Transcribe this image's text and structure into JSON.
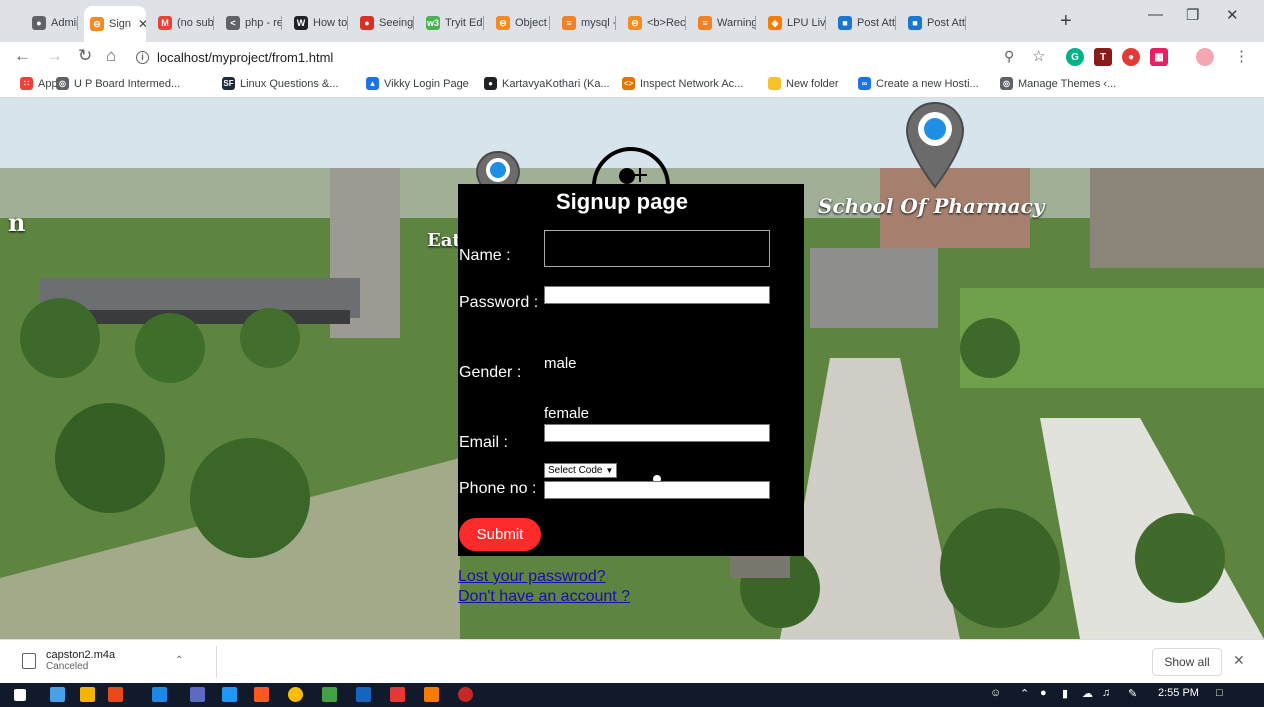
{
  "browser": {
    "tabs": [
      {
        "label": "Admin",
        "icon": "chrome-icon",
        "color": "#5f6368"
      },
      {
        "label": "Sign",
        "icon": "xampp-icon",
        "color": "#f28b22",
        "active": true
      },
      {
        "label": "(no sub",
        "icon": "gmail-icon",
        "color": "#ea4335"
      },
      {
        "label": "php - re",
        "icon": "code-icon",
        "color": "#5f6368"
      },
      {
        "label": "How to",
        "icon": "wiki-icon",
        "color": "#202124"
      },
      {
        "label": "Seeing",
        "icon": "red-circle-icon",
        "color": "#d93025"
      },
      {
        "label": "Tryit Ed",
        "icon": "w3-icon",
        "color": "#4caf50"
      },
      {
        "label": "Object",
        "icon": "xampp-icon",
        "color": "#f28b22"
      },
      {
        "label": "mysql -",
        "icon": "stack-icon",
        "color": "#f48024"
      },
      {
        "label": "<b>Rec",
        "icon": "xampp-icon",
        "color": "#f28b22"
      },
      {
        "label": "Warning",
        "icon": "stack-icon",
        "color": "#f48024"
      },
      {
        "label": "LPU Liv",
        "icon": "lpu-icon",
        "color": "#f57c00"
      },
      {
        "label": "Post Att",
        "icon": "blue-square-icon",
        "color": "#1976d2"
      },
      {
        "label": "Post Att",
        "icon": "blue-square-icon",
        "color": "#1976d2"
      }
    ],
    "new_tab": "+",
    "address": "localhost/myproject/from1.html",
    "bookmarks": [
      {
        "label": "Apps",
        "icon": "apps-grid-icon",
        "color": "#ea4335"
      },
      {
        "label": "U P Board Intermed...",
        "icon": "globe-icon",
        "color": "#5f6368"
      },
      {
        "label": "Linux Questions &...",
        "icon": "sf-icon",
        "color": "#1d2b3a"
      },
      {
        "label": "Vikky Login Page",
        "icon": "triangle-icon",
        "color": "#1a73e8"
      },
      {
        "label": "KartavyaKothari (Ka...",
        "icon": "github-icon",
        "color": "#202124"
      },
      {
        "label": "Inspect Network Ac...",
        "icon": "code-arrows-icon",
        "color": "#e37400"
      },
      {
        "label": "New folder",
        "icon": "folder-icon",
        "color": "#fbc02d"
      },
      {
        "label": "Create a new Hosti...",
        "icon": "infinity-icon",
        "color": "#1a73e8"
      },
      {
        "label": "Manage Themes ‹...",
        "icon": "globe-icon",
        "color": "#5f6368"
      }
    ]
  },
  "page": {
    "overlay_left": "n",
    "overlay_center": "Eat",
    "overlay_right": "School Of Pharmacy",
    "form": {
      "title": "Signup page",
      "name_label": "Name :",
      "password_label": "Password :",
      "gender_label": "Gender :",
      "gender_male": "male",
      "gender_female": "female",
      "email_label": "Email :",
      "phone_label": "Phone no :",
      "select_code": "Select Code",
      "select_arrow": "▼",
      "submit": "Submit"
    },
    "links": {
      "lost_password": "Lost your passwrod?",
      "no_account": "Don't have an account ?"
    }
  },
  "download": {
    "file_name": "capston2.m4a",
    "status": "Canceled",
    "show_all": "Show all"
  },
  "taskbar": {
    "time": "2:55 PM"
  },
  "colors": {
    "submit": "#ff2b2b",
    "form_bg": "#000000",
    "link": "#1a0dab"
  }
}
